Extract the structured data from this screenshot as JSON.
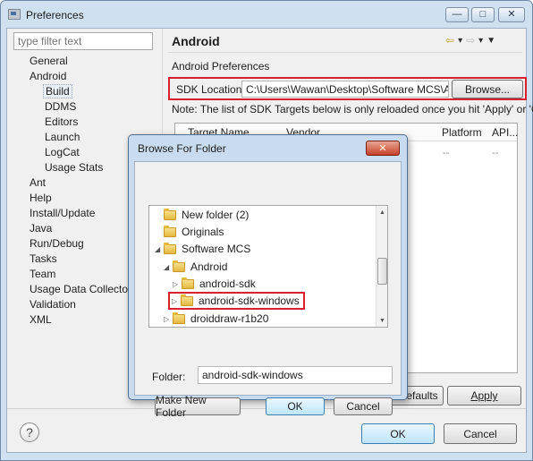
{
  "window": {
    "title": "Preferences",
    "minimize_glyph": "—",
    "maximize_glyph": "□",
    "close_glyph": "✕"
  },
  "filter": {
    "placeholder": "type filter text"
  },
  "tree": {
    "items": [
      "General",
      "Android",
      "Build",
      "DDMS",
      "Editors",
      "Launch",
      "LogCat",
      "Usage Stats",
      "Ant",
      "Help",
      "Install/Update",
      "Java",
      "Run/Debug",
      "Tasks",
      "Team",
      "Usage Data Collector",
      "Validation",
      "XML"
    ],
    "selected": "Build"
  },
  "pane": {
    "title": "Android",
    "section": "Android Preferences",
    "sdk_label": "SDK Location:",
    "sdk_value": "C:\\Users\\Wawan\\Desktop\\Software MCS\\Ar",
    "browse_label": "Browse...",
    "note": "Note: The list of SDK Targets below is only reloaded once you hit 'Apply' or 'OK'.",
    "columns": [
      "Target Name",
      "Vendor",
      "Platform",
      "API..."
    ],
    "row_values": [
      "--",
      "--"
    ],
    "restore_defaults_label": "efaults",
    "apply_label": "Apply"
  },
  "footer": {
    "help_glyph": "?",
    "ok_label": "OK",
    "cancel_label": "Cancel"
  },
  "dialog": {
    "title": "Browse For Folder",
    "close_glyph": "✕",
    "folders": [
      "New folder (2)",
      "Originals",
      "Software MCS",
      "Android",
      "android-sdk",
      "android-sdk-windows",
      "droiddraw-r1b20"
    ],
    "highlighted": "android-sdk-windows",
    "folder_label": "Folder:",
    "folder_value": "android-sdk-windows",
    "make_new_folder_label": "Make New Folder",
    "ok_label": "OK",
    "cancel_label": "Cancel"
  },
  "colors": {
    "highlight_border": "#d8202f",
    "title_bg": "#cfe0f1",
    "default_button": "#bee6fd"
  }
}
